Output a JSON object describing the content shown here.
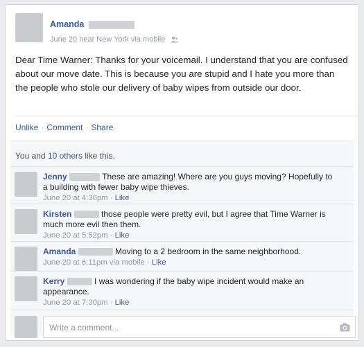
{
  "post": {
    "author": "Amanda",
    "date": "June 20",
    "location": "near New York",
    "via": "via mobile",
    "text": "Dear Time Warner: Thanks for your voicemail. I understand that you are confused about our move date. This is because you are stupid and I hate you more than the people who stole our delivery of baby wipes from outside our door."
  },
  "actions": {
    "unlike": "Unlike",
    "comment": "Comment",
    "share": "Share",
    "separator": "·"
  },
  "likes": {
    "prefix": "You and",
    "others": "10 others",
    "suffix": "like this."
  },
  "comments": [
    {
      "name": "Jenny",
      "text": "These are amazing! Where are you guys moving? Hopefully to a building with fewer baby wipe thieves.",
      "time": "June 20 at 4:36pm",
      "via": "",
      "like": "Like"
    },
    {
      "name": "Kirsten",
      "text": "those people were pretty evil, but I agree that Time Warner is much more evil then them.",
      "time": "June 20 at 5:52pm",
      "via": "",
      "like": "Like"
    },
    {
      "name": "Amanda",
      "text": "Moving to a 2 bedroom in the same neighborhood.",
      "time": "June 20 at 6:11pm",
      "via": "via mobile",
      "like": "Like"
    },
    {
      "name": "Kerry",
      "text": "I was wondering if the baby wipe incident would make an appearance.",
      "time": "June 20 at 7:30pm",
      "via": "",
      "like": "Like"
    }
  ],
  "composer": {
    "placeholder": "Write a comment..."
  },
  "icons": {
    "audience": "friends-icon",
    "photo": "camera-icon"
  },
  "colors": {
    "link": "#3b5998",
    "meta": "#9197a3",
    "redaction": "#cfd1d4"
  }
}
